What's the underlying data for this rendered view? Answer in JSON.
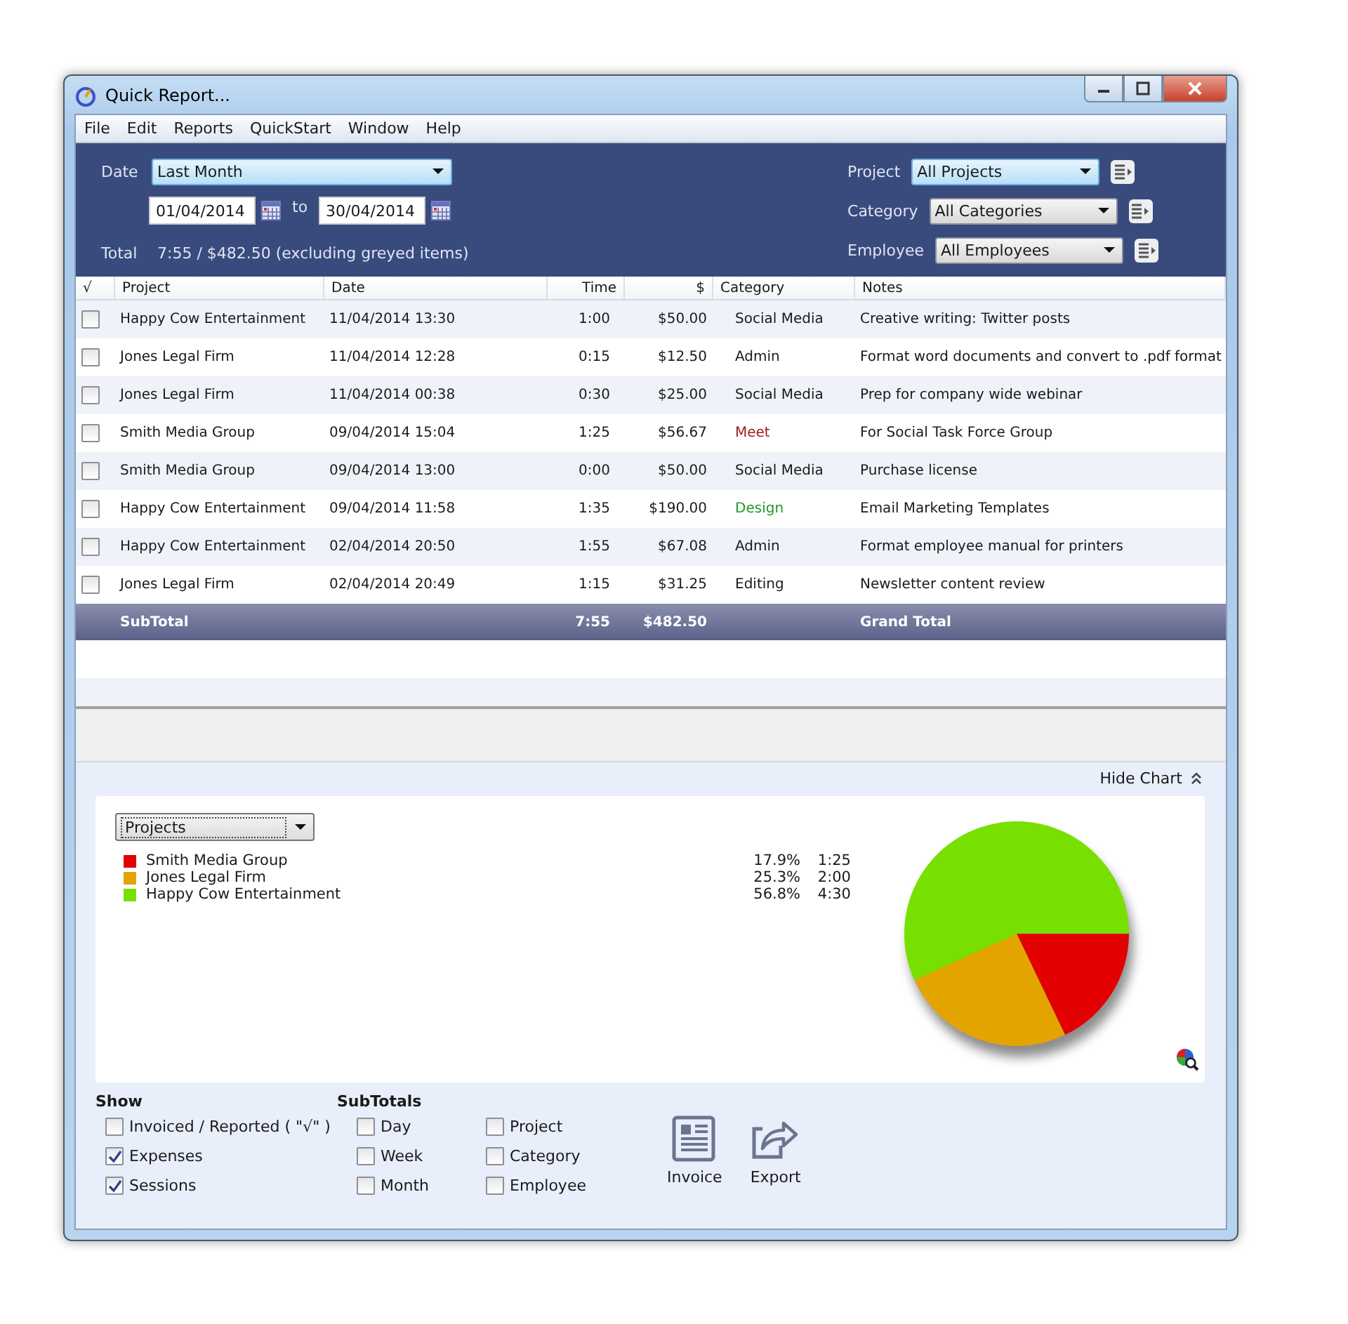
{
  "window": {
    "title": "Quick Report..."
  },
  "menu": [
    "File",
    "Edit",
    "Reports",
    "QuickStart",
    "Window",
    "Help"
  ],
  "filters": {
    "date_label": "Date",
    "date_range": "Last Month",
    "from": "01/04/2014",
    "to_label": "to",
    "to": "30/04/2014",
    "total_label": "Total",
    "total": "7:55 / $482.50 (excluding greyed items)",
    "selects": [
      {
        "label": "Project",
        "value": "All Projects",
        "selected": true
      },
      {
        "label": "Category",
        "value": "All Categories",
        "selected": false
      },
      {
        "label": "Employee",
        "value": "All Employees",
        "selected": false
      }
    ]
  },
  "table": {
    "columns": [
      "√",
      "Project",
      "Date",
      "Time",
      "$",
      "Category",
      "Notes"
    ],
    "rows": [
      {
        "checked": false,
        "project": "Happy Cow Entertainment",
        "date": "11/04/2014  13:30",
        "time": "1:00",
        "amount": "$50.00",
        "category": "Social Media",
        "color": "#1a1a1a",
        "notes": "Creative writing: Twitter posts"
      },
      {
        "checked": false,
        "project": "Jones Legal Firm",
        "date": "11/04/2014  12:28",
        "time": "0:15",
        "amount": "$12.50",
        "category": "Admin",
        "color": "#1a1a1a",
        "notes": "Format word documents and convert to .pdf format"
      },
      {
        "checked": false,
        "project": "Jones Legal Firm",
        "date": "11/04/2014  00:38",
        "time": "0:30",
        "amount": "$25.00",
        "category": "Social Media",
        "color": "#1a1a1a",
        "notes": "Prep for company wide webinar"
      },
      {
        "checked": false,
        "project": "Smith Media Group",
        "date": "09/04/2014  15:04",
        "time": "1:25",
        "amount": "$56.67",
        "category": "Meet",
        "color": "#a01e1e",
        "notes": "For Social Task Force Group"
      },
      {
        "checked": false,
        "project": "Smith Media Group",
        "date": "09/04/2014  13:00",
        "time": "0:00",
        "amount": "$50.00",
        "category": "Social Media",
        "color": "#1a1a1a",
        "notes": "Purchase license"
      },
      {
        "checked": false,
        "project": "Happy Cow Entertainment",
        "date": "09/04/2014  11:58",
        "time": "1:35",
        "amount": "$190.00",
        "category": "Design",
        "color": "#1f9a2a",
        "notes": "Email Marketing Templates"
      },
      {
        "checked": false,
        "project": "Happy Cow Entertainment",
        "date": "02/04/2014  20:50",
        "time": "1:55",
        "amount": "$67.08",
        "category": "Admin",
        "color": "#1a1a1a",
        "notes": "Format employee manual for printers"
      },
      {
        "checked": false,
        "project": "Jones Legal Firm",
        "date": "02/04/2014  20:49",
        "time": "1:15",
        "amount": "$31.25",
        "category": "Editing",
        "color": "#1a1a1a",
        "notes": "Newsletter content review"
      }
    ],
    "subtotal": {
      "label": "SubTotal",
      "time": "7:55",
      "amount": "$482.50",
      "notes": "Grand Total"
    }
  },
  "chart_panel": {
    "toggle": "Hide Chart",
    "legend": [
      {
        "percent": "17.9%",
        "time": "1:25",
        "color": "#e20000"
      },
      {
        "percent": "25.3%",
        "time": "2:00",
        "color": "#e4a400"
      },
      {
        "percent": "56.8%",
        "time": "4:30",
        "color": "#78e000"
      }
    ],
    "chart_data": {
      "type": "pie",
      "categories": [
        "Smith Media Group",
        "Jones Legal Firm",
        "Happy Cow Entertainment"
      ],
      "series": [
        {
          "name": "Projects",
          "values": [
            17.9,
            25.3,
            56.8
          ]
        }
      ]
    }
  },
  "show": {
    "title": "Show",
    "options": [
      {
        "label": "Invoiced / Reported ( \"√\" )",
        "checked": false
      },
      {
        "label": "Expenses",
        "checked": true
      },
      {
        "label": "Sessions",
        "checked": true
      }
    ]
  },
  "subtotals": {
    "title": "SubTotals",
    "options": [
      {
        "label": "Day",
        "checked": false
      },
      {
        "label": "Week",
        "checked": false
      },
      {
        "label": "Month",
        "checked": false
      },
      {
        "label": "Project",
        "checked": false
      },
      {
        "label": "Category",
        "checked": false
      },
      {
        "label": "Employee",
        "checked": false
      }
    ]
  },
  "actions": [
    {
      "label": "Invoice",
      "kind": "invoice"
    },
    {
      "label": "Export",
      "kind": "export"
    }
  ]
}
